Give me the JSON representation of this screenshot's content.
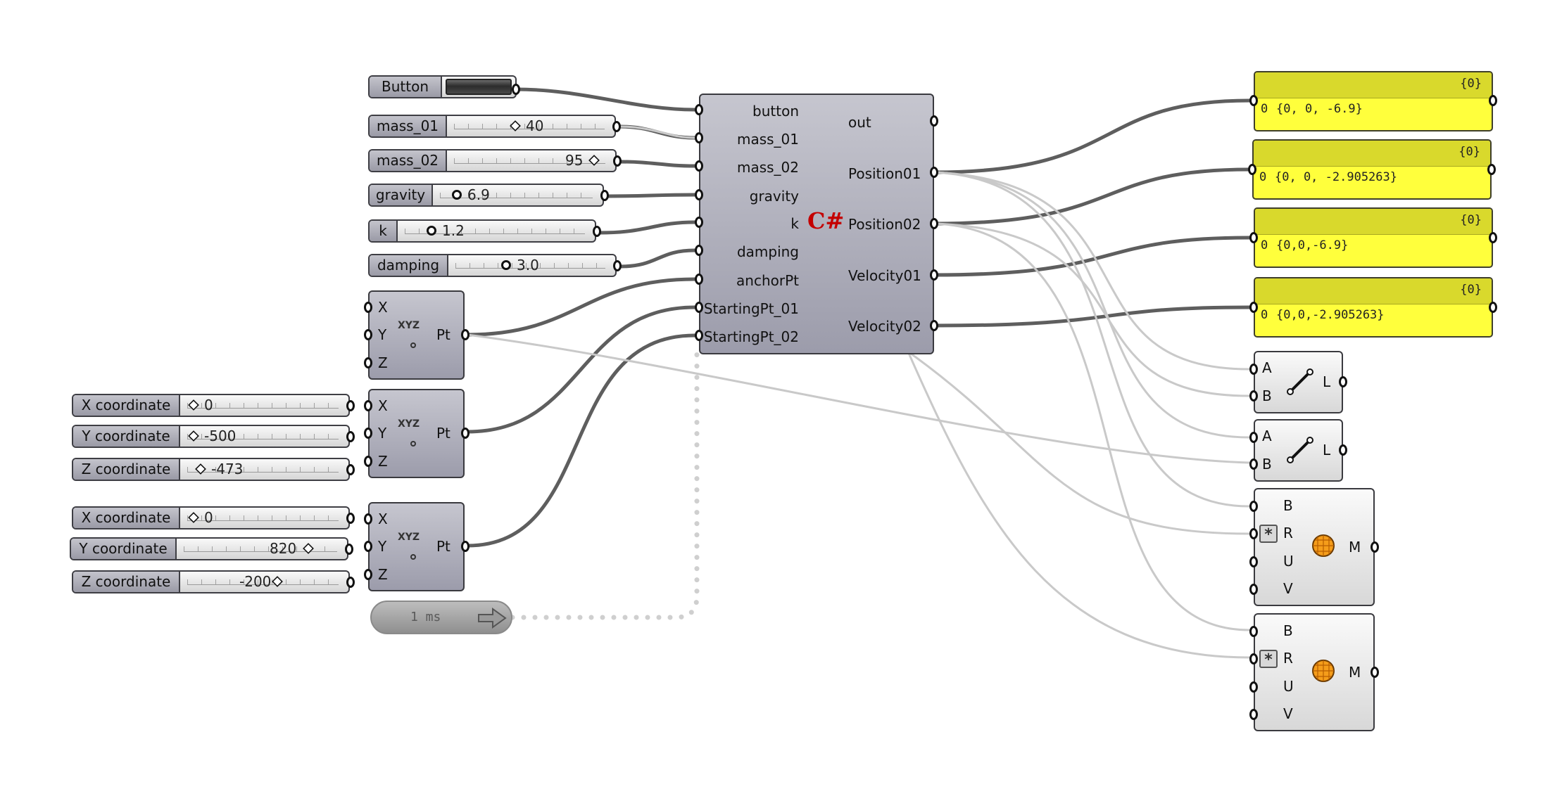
{
  "button": {
    "label": "Button"
  },
  "sliders": [
    {
      "label": "mass_01",
      "value": "40"
    },
    {
      "label": "mass_02",
      "value": "95"
    },
    {
      "label": "gravity",
      "value": "6.9"
    },
    {
      "label": "k",
      "value": "1.2"
    },
    {
      "label": "damping",
      "value": "3.0"
    }
  ],
  "coord_sliders": [
    {
      "label": "X coordinate",
      "value": "0"
    },
    {
      "label": "Y coordinate",
      "value": "-500"
    },
    {
      "label": "Z coordinate",
      "value": "-473"
    },
    {
      "label": "X coordinate",
      "value": "0"
    },
    {
      "label": "Y coordinate",
      "value": "820"
    },
    {
      "label": "Z coordinate",
      "value": "-200"
    }
  ],
  "construct_point": {
    "inputs": [
      "X",
      "Y",
      "Z"
    ],
    "output": "Pt",
    "icon_text": "XYZ"
  },
  "timer": {
    "label": "1 ms"
  },
  "script": {
    "icon_text": "C#",
    "inputs": [
      "button",
      "mass_01",
      "mass_02",
      "gravity",
      "k",
      "damping",
      "anchorPt",
      "StartingPt_01",
      "StartingPt_02"
    ],
    "outputs": [
      "out",
      "Position01",
      "Position02",
      "Velocity01",
      "Velocity02"
    ]
  },
  "panels": [
    {
      "path": "{0}",
      "index": "0",
      "value": "{0, 0, -6.9}"
    },
    {
      "path": "{0}",
      "index": "0",
      "value": "{0, 0, -2.905263}"
    },
    {
      "path": "{0}",
      "index": "0",
      "value": "{0,0,-6.9}"
    },
    {
      "path": "{0}",
      "index": "0",
      "value": "{0,0,-2.905263}"
    }
  ],
  "line_component": {
    "inputs": [
      "A",
      "B"
    ],
    "output": "L"
  },
  "mesh_sphere": {
    "inputs": [
      "B",
      "R",
      "U",
      "V"
    ],
    "output": "M"
  },
  "colors": {
    "canvas": "#ffffff",
    "panel": "#ffff3c",
    "wire": "#636363",
    "script_icon": "#c40000"
  }
}
